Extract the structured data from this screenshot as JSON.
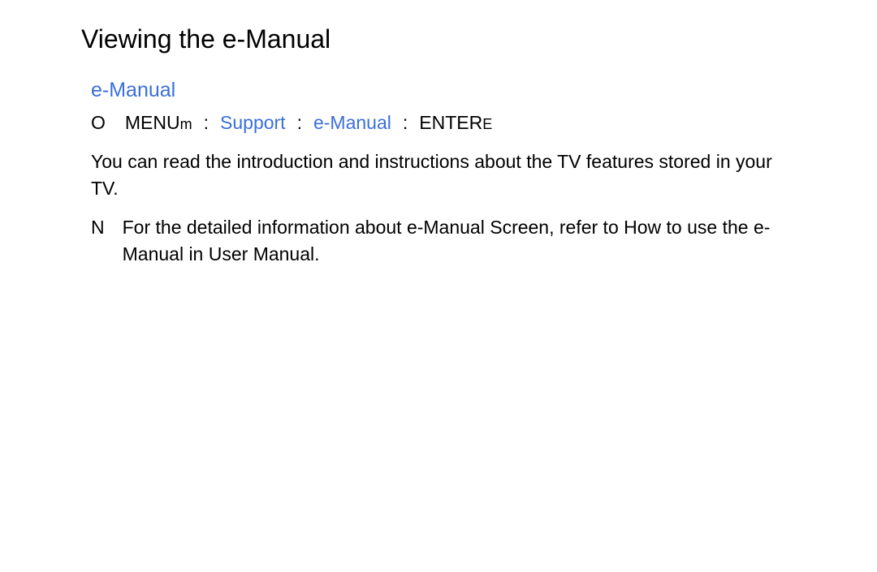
{
  "title": "Viewing the e-Manual",
  "section_title": "e-Manual",
  "nav": {
    "marker": "O",
    "menu": "MENU",
    "menu_suffix": "m",
    "sep1": ":",
    "support": "Support",
    "sep2": ":",
    "emanual": "e-Manual",
    "sep3": ":",
    "enter": "ENTER",
    "enter_suffix": "E"
  },
  "paragraph": "You can read the introduction and instructions about the TV features stored in your TV.",
  "note": {
    "marker": "N",
    "text": "For the detailed information about e-Manual Screen, refer to  How to use the e-Manual  in User Manual."
  }
}
